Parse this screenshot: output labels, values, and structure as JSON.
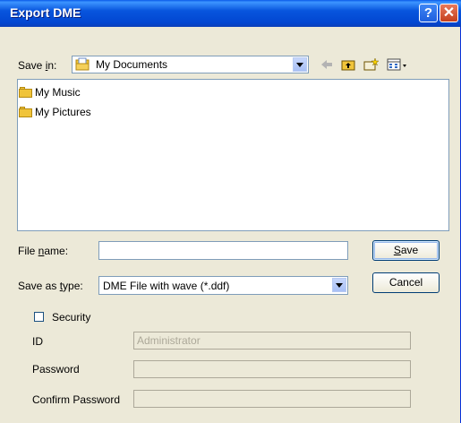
{
  "window": {
    "title": "Export DME",
    "help_glyph": "?",
    "close_glyph": "✕"
  },
  "savein": {
    "label_pre": "Save ",
    "label_u": "i",
    "label_post": "n:",
    "value": "My Documents"
  },
  "files": [
    {
      "name": "My Music"
    },
    {
      "name": "My Pictures"
    }
  ],
  "filename": {
    "label_pre": "File ",
    "label_u": "n",
    "label_post": "ame:",
    "value": ""
  },
  "savetype": {
    "label_pre": "Save as ",
    "label_u": "t",
    "label_post": "ype:",
    "value": "DME File with wave (*.ddf)"
  },
  "buttons": {
    "save_u": "S",
    "save_rest": "ave",
    "cancel": "Cancel"
  },
  "security": {
    "label": "Security",
    "checked": false
  },
  "id_field": {
    "label": "ID",
    "value": "Administrator"
  },
  "password": {
    "label": "Password",
    "value": ""
  },
  "confirm": {
    "label": "Confirm Password",
    "value": ""
  },
  "icons": [
    "back-arrow-icon",
    "up-folder-icon",
    "new-folder-icon",
    "views-menu-icon",
    "folder-icon"
  ]
}
